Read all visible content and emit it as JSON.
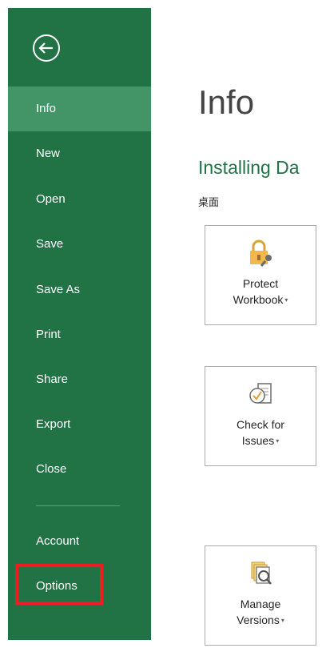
{
  "sidebar": {
    "back_icon": "back-arrow-circle-icon",
    "items": [
      {
        "label": "Info",
        "selected": true
      },
      {
        "label": "New"
      },
      {
        "label": "Open"
      },
      {
        "label": "Save"
      },
      {
        "label": "Save As"
      },
      {
        "label": "Print"
      },
      {
        "label": "Share"
      },
      {
        "label": "Export"
      },
      {
        "label": "Close"
      },
      {
        "label": "Account"
      },
      {
        "label": "Options",
        "highlighted": true
      }
    ]
  },
  "main": {
    "title": "Info",
    "document_title": "Installing Da",
    "document_path": "桌面",
    "tiles": [
      {
        "icon": "lock-key-icon",
        "line1": "Protect",
        "line2": "Workbook",
        "caret": "▾"
      },
      {
        "icon": "check-document-icon",
        "line1": "Check for",
        "line2": "Issues",
        "caret": "▾"
      },
      {
        "icon": "manage-versions-icon",
        "line1": "Manage",
        "line2": "Versions",
        "caret": "▾"
      }
    ]
  },
  "colors": {
    "sidebar_bg": "#217346",
    "selected_bg": "#439467",
    "accent_text": "#217346",
    "highlight_border": "#ee1c25"
  }
}
